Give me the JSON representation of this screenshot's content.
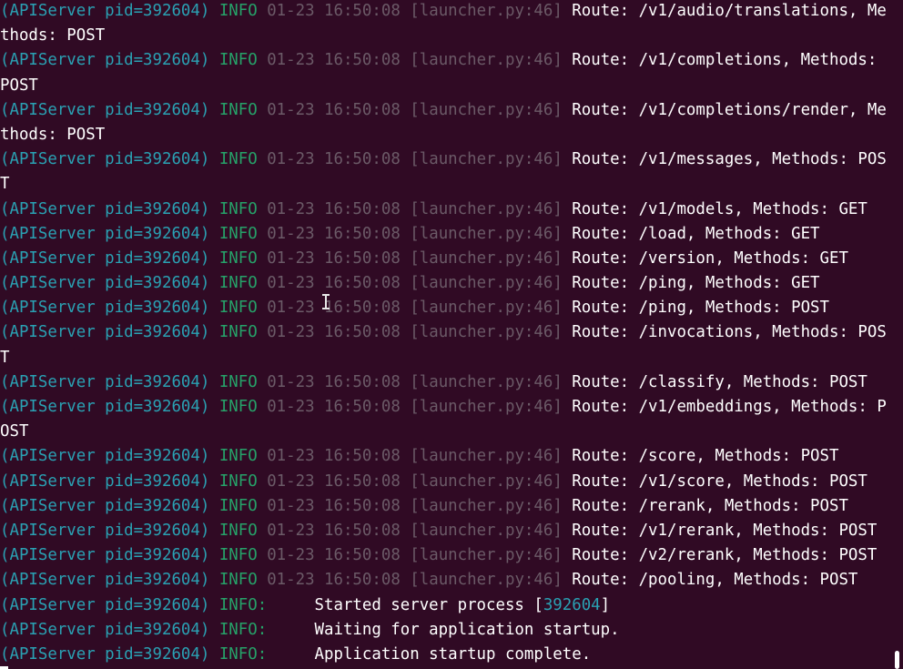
{
  "terminal": {
    "lines": [
      {
        "prefix": "(APIServer pid=392604)",
        "level": "INFO",
        "ts": "01-23 16:50:08",
        "src": "[launcher.py:46]",
        "msg": "Route: /v1/audio/translations, Me"
      },
      {
        "text": "thods: POST"
      },
      {
        "prefix": "(APIServer pid=392604)",
        "level": "INFO",
        "ts": "01-23 16:50:08",
        "src": "[launcher.py:46]",
        "msg": "Route: /v1/completions, Methods:"
      },
      {
        "text": "POST"
      },
      {
        "prefix": "(APIServer pid=392604)",
        "level": "INFO",
        "ts": "01-23 16:50:08",
        "src": "[launcher.py:46]",
        "msg": "Route: /v1/completions/render, Me"
      },
      {
        "text": "thods: POST"
      },
      {
        "prefix": "(APIServer pid=392604)",
        "level": "INFO",
        "ts": "01-23 16:50:08",
        "src": "[launcher.py:46]",
        "msg": "Route: /v1/messages, Methods: POS"
      },
      {
        "text": "T"
      },
      {
        "prefix": "(APIServer pid=392604)",
        "level": "INFO",
        "ts": "01-23 16:50:08",
        "src": "[launcher.py:46]",
        "msg": "Route: /v1/models, Methods: GET"
      },
      {
        "prefix": "(APIServer pid=392604)",
        "level": "INFO",
        "ts": "01-23 16:50:08",
        "src": "[launcher.py:46]",
        "msg": "Route: /load, Methods: GET"
      },
      {
        "prefix": "(APIServer pid=392604)",
        "level": "INFO",
        "ts": "01-23 16:50:08",
        "src": "[launcher.py:46]",
        "msg": "Route: /version, Methods: GET"
      },
      {
        "prefix": "(APIServer pid=392604)",
        "level": "INFO",
        "ts": "01-23 16:50:08",
        "src": "[launcher.py:46]",
        "msg": "Route: /ping, Methods: GET"
      },
      {
        "prefix": "(APIServer pid=392604)",
        "level": "INFO",
        "ts": "01-23 16:50:08",
        "src": "[launcher.py:46]",
        "msg": "Route: /ping, Methods: POST"
      },
      {
        "prefix": "(APIServer pid=392604)",
        "level": "INFO",
        "ts": "01-23 16:50:08",
        "src": "[launcher.py:46]",
        "msg": "Route: /invocations, Methods: POS"
      },
      {
        "text": "T"
      },
      {
        "prefix": "(APIServer pid=392604)",
        "level": "INFO",
        "ts": "01-23 16:50:08",
        "src": "[launcher.py:46]",
        "msg": "Route: /classify, Methods: POST"
      },
      {
        "prefix": "(APIServer pid=392604)",
        "level": "INFO",
        "ts": "01-23 16:50:08",
        "src": "[launcher.py:46]",
        "msg": "Route: /v1/embeddings, Methods: P"
      },
      {
        "text": "OST"
      },
      {
        "prefix": "(APIServer pid=392604)",
        "level": "INFO",
        "ts": "01-23 16:50:08",
        "src": "[launcher.py:46]",
        "msg": "Route: /score, Methods: POST"
      },
      {
        "prefix": "(APIServer pid=392604)",
        "level": "INFO",
        "ts": "01-23 16:50:08",
        "src": "[launcher.py:46]",
        "msg": "Route: /v1/score, Methods: POST"
      },
      {
        "prefix": "(APIServer pid=392604)",
        "level": "INFO",
        "ts": "01-23 16:50:08",
        "src": "[launcher.py:46]",
        "msg": "Route: /rerank, Methods: POST"
      },
      {
        "prefix": "(APIServer pid=392604)",
        "level": "INFO",
        "ts": "01-23 16:50:08",
        "src": "[launcher.py:46]",
        "msg": "Route: /v1/rerank, Methods: POST"
      },
      {
        "prefix": "(APIServer pid=392604)",
        "level": "INFO",
        "ts": "01-23 16:50:08",
        "src": "[launcher.py:46]",
        "msg": "Route: /v2/rerank, Methods: POST"
      },
      {
        "prefix": "(APIServer pid=392604)",
        "level": "INFO",
        "ts": "01-23 16:50:08",
        "src": "[launcher.py:46]",
        "msg": "Route: /pooling, Methods: POST"
      },
      {
        "prefix": "(APIServer pid=392604)",
        "level": "INFO:",
        "gap": "     ",
        "msg": "Started server process [",
        "num": "392604",
        "tail": "]"
      },
      {
        "prefix": "(APIServer pid=392604)",
        "level": "INFO:",
        "gap": "     ",
        "msg": "Waiting for application startup."
      },
      {
        "prefix": "(APIServer pid=392604)",
        "level": "INFO:",
        "gap": "     ",
        "msg": "Application startup complete."
      }
    ]
  },
  "colors": {
    "background": "#300a24",
    "prefix": "#2aa1b3",
    "info": "#26a269",
    "dim": "#6b5a67",
    "text": "#ffffff"
  },
  "icons": {
    "mouse_cursor": "text-cursor-icon"
  }
}
